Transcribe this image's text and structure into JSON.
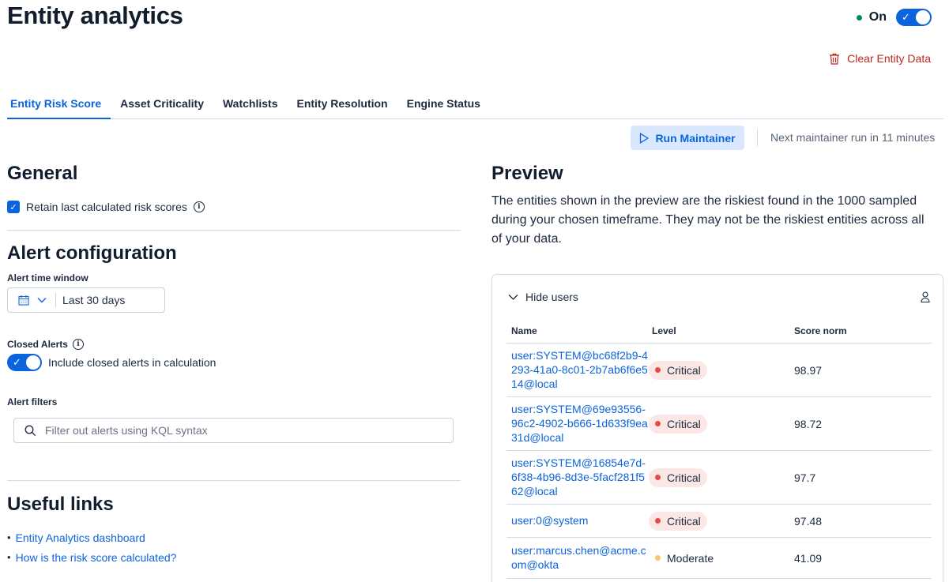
{
  "header": {
    "title": "Entity analytics",
    "status_label": "On",
    "clear_label": "Clear Entity Data"
  },
  "tabs": [
    {
      "label": "Entity Risk Score",
      "active": true
    },
    {
      "label": "Asset Criticality"
    },
    {
      "label": "Watchlists"
    },
    {
      "label": "Entity Resolution"
    },
    {
      "label": "Engine Status"
    }
  ],
  "maintainer": {
    "run_label": "Run Maintainer",
    "next_run": "Next maintainer run in 11 minutes"
  },
  "general": {
    "title": "General",
    "retain_label": "Retain last calculated risk scores",
    "retain_checked": true
  },
  "alert_config": {
    "title": "Alert configuration",
    "time_window_label": "Alert time window",
    "time_window_value": "Last 30 days",
    "closed_alerts_label": "Closed Alerts",
    "include_closed_label": "Include closed alerts in calculation",
    "include_closed_on": true,
    "filters_label": "Alert filters",
    "filters_placeholder": "Filter out alerts using KQL syntax"
  },
  "useful_links": {
    "title": "Useful links",
    "items": [
      "Entity Analytics dashboard",
      "How is the risk score calculated?"
    ]
  },
  "preview": {
    "title": "Preview",
    "description": "The entities shown in the preview are the riskiest found in the 1000 sampled during your chosen timeframe. They may not be the riskiest entities across all of your data.",
    "toggle_label": "Hide users",
    "columns": {
      "name": "Name",
      "level": "Level",
      "score": "Score norm"
    },
    "rows": [
      {
        "name": "user:SYSTEM@bc68f2b9-4293-41a0-8c01-2b7ab6f6e514@local",
        "level": "Critical",
        "score": "98.97"
      },
      {
        "name": "user:SYSTEM@69e93556-96c2-4902-b666-1d633f9ea31d@local",
        "level": "Critical",
        "score": "98.72"
      },
      {
        "name": "user:SYSTEM@16854e7d-6f38-4b96-8d3e-5facf281f562@local",
        "level": "Critical",
        "score": "97.7"
      },
      {
        "name": "user:0@system",
        "level": "Critical",
        "score": "97.48"
      },
      {
        "name": "user:marcus.chen@acme.com@okta",
        "level": "Moderate",
        "score": "41.09"
      }
    ]
  },
  "colors": {
    "accent": "#0b64dd",
    "danger": "#bd271e",
    "critical_dot": "#e7484a",
    "moderate_dot": "#f5c66e",
    "status_dot": "#008a5e"
  }
}
